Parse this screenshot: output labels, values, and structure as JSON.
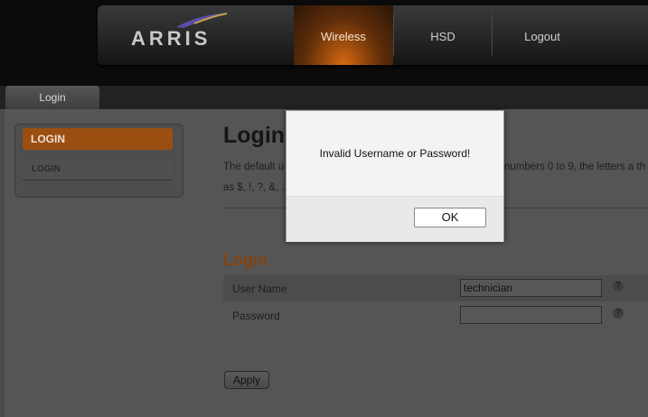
{
  "header": {
    "logo_text": "ARRIS",
    "nav": {
      "wireless": "Wireless",
      "hsd": "HSD",
      "logout": "Logout"
    }
  },
  "tabs": {
    "login": "Login"
  },
  "sidebar": {
    "header": "LOGIN",
    "item": "LOGIN"
  },
  "main": {
    "title": "Login",
    "description_line1": "The default u",
    "description_line1_tail": "numbers 0 to 9, the letters a th",
    "description_line2": "as $, !, ?, &, ...",
    "section_title": "Login",
    "username_label": "User Name",
    "username_value": "technician",
    "password_label": "Password",
    "password_value": "",
    "help_glyph": "?",
    "apply_label": "Apply"
  },
  "dialog": {
    "message": "Invalid Username or Password!",
    "ok_label": "OK"
  },
  "colors": {
    "accent": "#d66a12",
    "sidebar_header": "#9a4f11",
    "section_title": "#83430f"
  }
}
